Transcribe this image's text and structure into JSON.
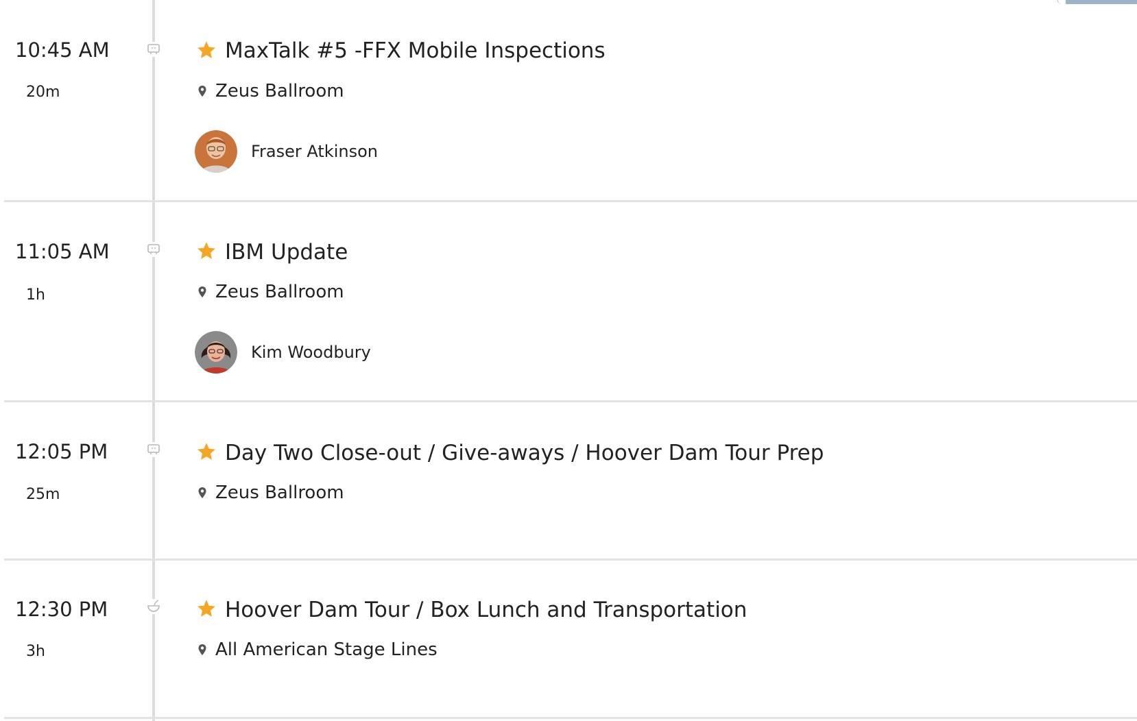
{
  "sessions": [
    {
      "time": "10:45 AM",
      "duration": "20m",
      "type_icon": "presentation-icon",
      "starred": true,
      "title": "MaxTalk #5 -FFX Mobile Inspections",
      "location": "Zeus Ballroom",
      "speaker": "Fraser Atkinson"
    },
    {
      "time": "11:05 AM",
      "duration": "1h",
      "type_icon": "presentation-icon",
      "starred": true,
      "title": "IBM Update",
      "location": "Zeus Ballroom",
      "speaker": "Kim Woodbury"
    },
    {
      "time": "12:05 PM",
      "duration": "25m",
      "type_icon": "presentation-icon",
      "starred": true,
      "title": "Day Two Close-out / Give-aways / Hoover Dam Tour Prep",
      "location": "Zeus Ballroom"
    },
    {
      "time": "12:30 PM",
      "duration": "3h",
      "type_icon": "meal-icon",
      "starred": true,
      "title": "Hoover Dam Tour / Box Lunch and Transportation",
      "location": "All American Stage Lines"
    }
  ],
  "colors": {
    "star": "#f5a623",
    "timeline": "#dcdcdc",
    "divider": "#e3e3e3",
    "icon": "#b8b8b8",
    "pin": "#555555",
    "text": "#222222"
  }
}
